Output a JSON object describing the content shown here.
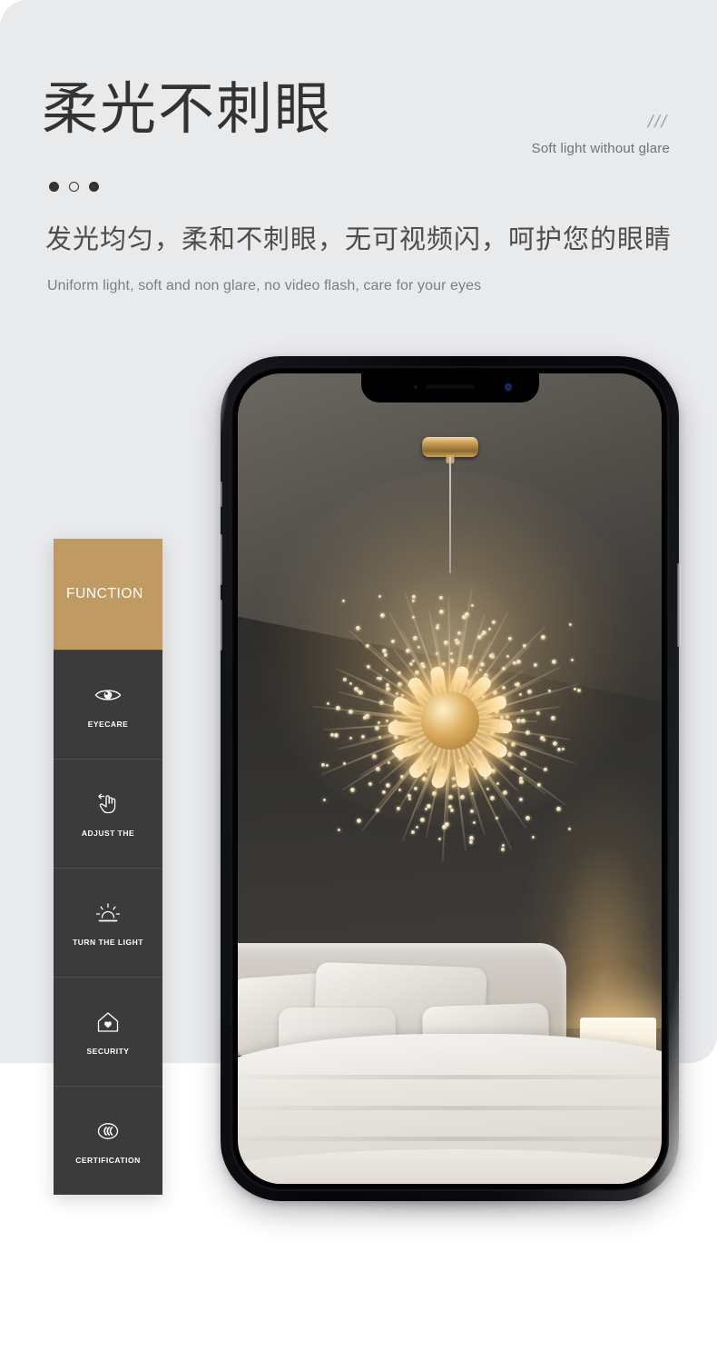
{
  "page": {
    "headline_cn": "柔光不刺眼",
    "headline_en": "Soft light without glare",
    "slashes": "///",
    "subtitle_cn": "发光均匀，柔和不刺眼，无可视频闪，呵护您的眼睛",
    "subtitle_en": "Uniform light, soft and non glare, no video flash, care for your eyes",
    "accent_color": "#c09a63",
    "panel_color": "#e9eaec",
    "sidebar_color": "#3b3b3b",
    "text_color": "#333333"
  },
  "carousel": {
    "dots": [
      {
        "state": "filled"
      },
      {
        "state": "hollow"
      },
      {
        "state": "filled"
      }
    ]
  },
  "sidebar": {
    "title": "FUNCTION",
    "items": [
      {
        "label": "EYECARE",
        "icon": "eye-icon"
      },
      {
        "label": "ADJUST THE",
        "icon": "hand-gesture-icon"
      },
      {
        "label": "TURN THE LIGHT",
        "icon": "sunrise-dimmer-icon"
      },
      {
        "label": "SECURITY",
        "icon": "house-heart-icon"
      },
      {
        "label": "CERTIFICATION",
        "icon": "ccc-mark-icon"
      }
    ]
  },
  "device": {
    "type": "smartphone-mockup",
    "screen_content": "bedroom-with-crystal-dandelion-chandelier"
  }
}
